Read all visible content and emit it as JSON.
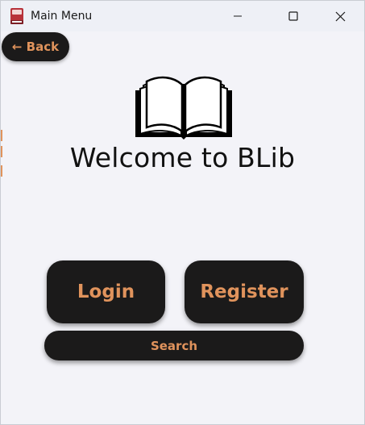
{
  "window": {
    "title": "Main Menu",
    "icons": {
      "app": "red-book-icon",
      "minimize": "minimize-icon",
      "maximize": "maximize-icon",
      "close": "close-icon"
    }
  },
  "nav": {
    "back_label": "← Back"
  },
  "hero": {
    "logo": "open-book-icon",
    "welcome_text": "Welcome to BLib"
  },
  "actions": {
    "login_label": "Login",
    "register_label": "Register",
    "search_label": "Search"
  },
  "colors": {
    "button_bg": "#1b1a1a",
    "button_text": "#e0935c",
    "window_bg": "#f3f3f8",
    "titlebar_bg": "#eef0f6"
  }
}
